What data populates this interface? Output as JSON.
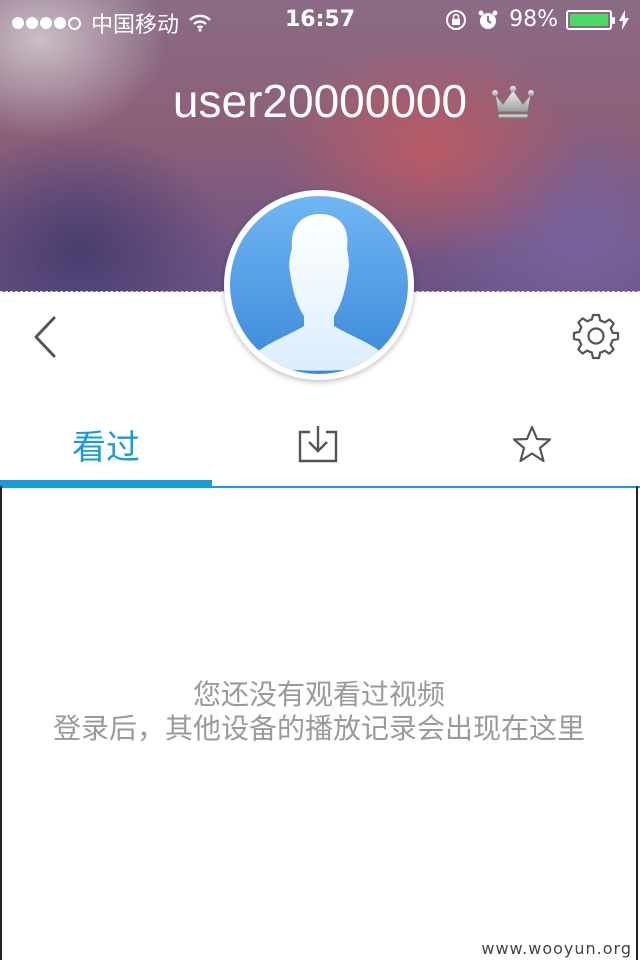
{
  "status_bar": {
    "carrier": "中国移动",
    "time": "16:57",
    "battery": "98%",
    "signal_bars": 4,
    "signal_max": 5
  },
  "profile": {
    "username": "user20000000",
    "crown_icon": "crown-icon",
    "avatar_icon": "user-avatar-icon"
  },
  "nav": {
    "back_icon": "chevron-left-icon",
    "settings_icon": "gear-icon"
  },
  "tabs": [
    {
      "label": "看过",
      "active": true
    },
    {
      "icon": "download-icon",
      "active": false
    },
    {
      "icon": "star-icon",
      "active": false
    }
  ],
  "empty_state": {
    "line1": "您还没有观看过视频",
    "line2": "登录后，其他设备的播放记录会出现在这里"
  },
  "watermark": "www.wooyun.org",
  "colors": {
    "accent": "#1a9ad6",
    "battery": "#4cd964",
    "empty_text": "#9a9a9a"
  }
}
